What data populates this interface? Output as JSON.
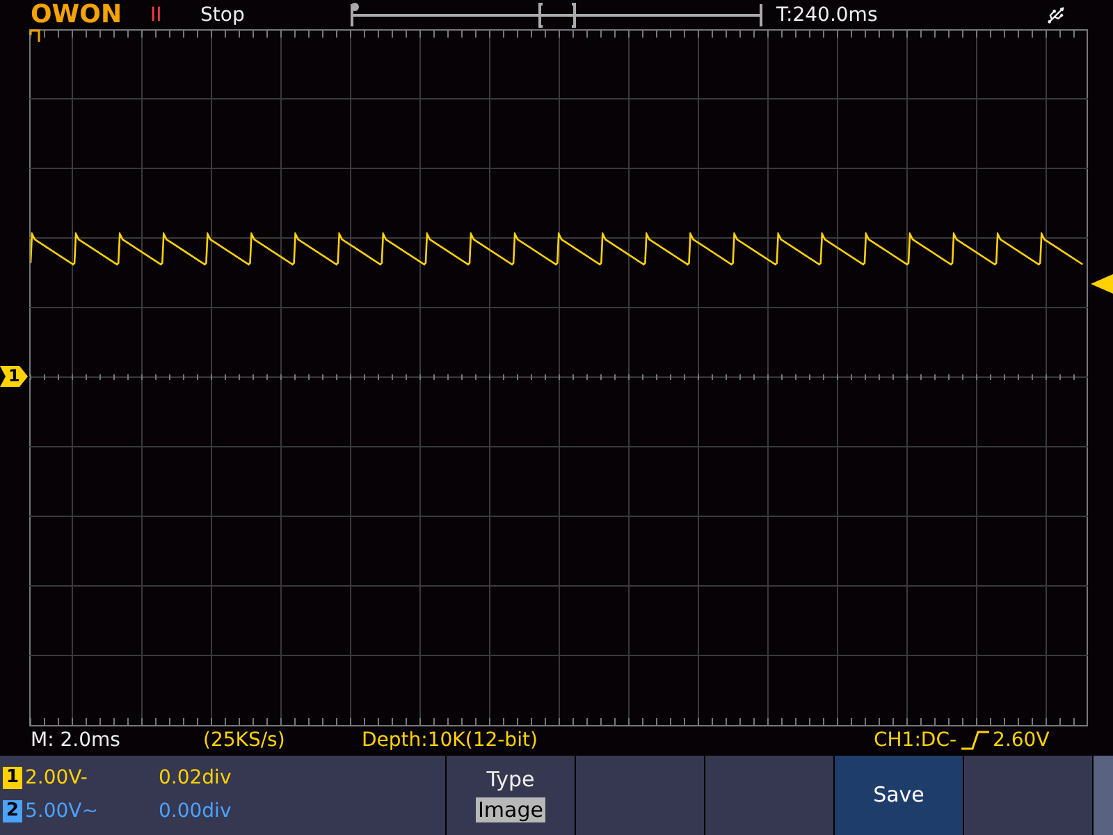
{
  "header": {
    "logo": "OWON",
    "run_icon": "II",
    "run_state": "Stop",
    "trigger_time": "T:240.0ms"
  },
  "channel_marker": {
    "label": "1",
    "color": "#ffd200"
  },
  "status_bar": {
    "timebase": "M: 2.0ms",
    "sample_rate": "(25KS/s)",
    "depth": "Depth:10K(12-bit)",
    "trigger_source": "CH1:DC-",
    "trigger_level": "2.60V"
  },
  "channels": [
    {
      "number": "1",
      "scale": "2.00V-",
      "offset": "0.02div",
      "color": "#ffd200"
    },
    {
      "number": "2",
      "scale": "5.00V~",
      "offset": "0.00div",
      "color": "#4aa3ff"
    }
  ],
  "softkeys": [
    {
      "kind": "option",
      "label": "Type",
      "value": "Image",
      "selected": false
    },
    {
      "kind": "empty",
      "selected": false
    },
    {
      "kind": "empty",
      "selected": false
    },
    {
      "kind": "button",
      "label": "Save",
      "selected": true
    },
    {
      "kind": "empty",
      "selected": false
    }
  ]
}
